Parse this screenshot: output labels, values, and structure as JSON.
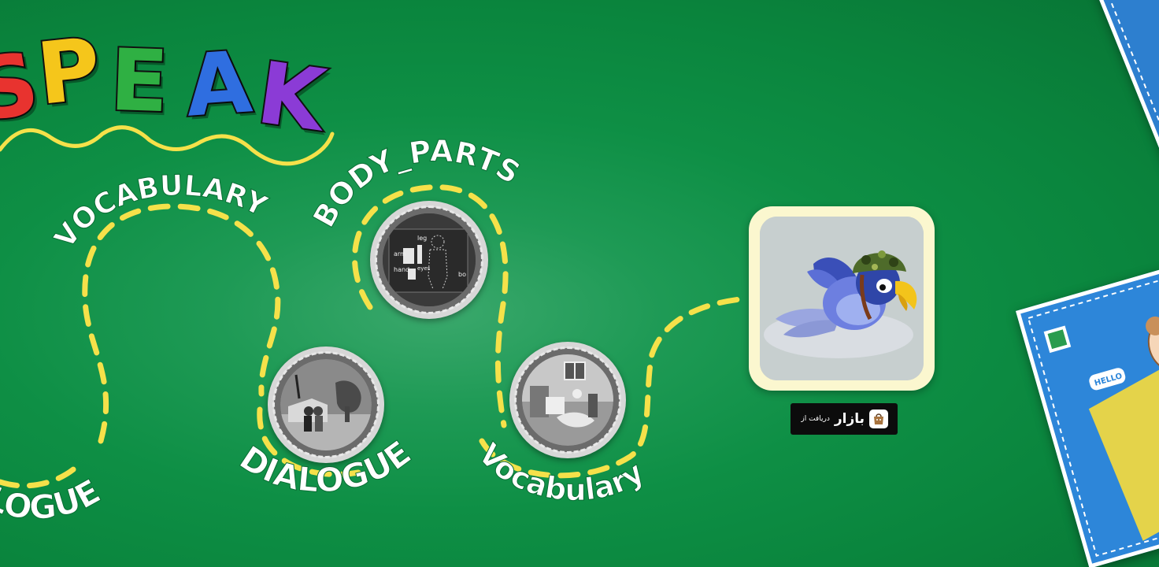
{
  "title": {
    "letters": [
      "S",
      "P",
      "E",
      "A",
      "K"
    ],
    "colors": [
      "#e8332f",
      "#f5c61b",
      "#2fb043",
      "#2f6ee0",
      "#8b3bd6"
    ],
    "underline_color": "#f5e14a"
  },
  "labels": {
    "vocabulary_top": "VOCABULARY",
    "body_parts": "BODY_PARTS",
    "dialogue_left": "LOGUE",
    "dialogue_center": "DIALOGUE",
    "vocabulary_bottom": "Vocabulary"
  },
  "body_parts_medal_words": [
    "leg",
    "arm",
    "hand",
    "eyes",
    "bo"
  ],
  "path_color": "#f5e14a",
  "app": {
    "icon_name": "parrot-helmet-icon"
  },
  "bazaar": {
    "caption": "دریافت از",
    "name": "بازار",
    "logo_icon": "shopping-bag-icon"
  },
  "book": {
    "hello_text": "HELLO"
  }
}
